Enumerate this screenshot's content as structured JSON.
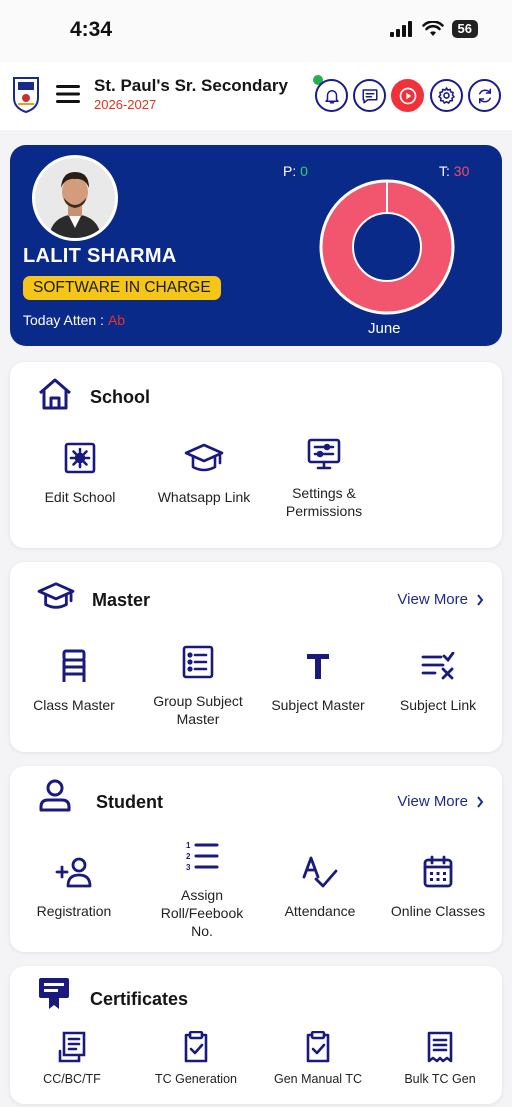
{
  "status_bar": {
    "time": "4:34",
    "battery": "56"
  },
  "header": {
    "school_name": "St. Paul's Sr. Secondary",
    "session": "2026-2027",
    "icons": [
      "bell-icon",
      "chat-icon",
      "play-icon",
      "gear-icon",
      "refresh-icon"
    ]
  },
  "profile": {
    "name": "LALIT SHARMA",
    "role": "SOFTWARE IN CHARGE",
    "attendance_label": "Today Atten :",
    "attendance_value": "Ab",
    "p_label": "P:",
    "p_value": "0",
    "t_label": "T:",
    "t_value": "30",
    "month": "June",
    "colors": {
      "card": "#0a2a8a",
      "donut": "#f2566f",
      "present": "#2bd36b",
      "total": "#f24b6a"
    }
  },
  "school_section": {
    "title": "School",
    "items": [
      {
        "label": "Edit School",
        "icon": "settings-box-icon"
      },
      {
        "label": "Whatsapp Link",
        "icon": "graduation-cap-icon"
      },
      {
        "label": "Settings & Permissions",
        "icon": "monitor-sliders-icon"
      }
    ]
  },
  "master_section": {
    "title": "Master",
    "view_more": "View More",
    "items": [
      {
        "label": "Class Master",
        "icon": "chair-icon"
      },
      {
        "label": "Group Subject Master",
        "icon": "list-box-icon"
      },
      {
        "label": "Subject Master",
        "icon": "text-t-icon"
      },
      {
        "label": "Subject Link",
        "icon": "list-check-icon"
      }
    ]
  },
  "student_section": {
    "title": "Student",
    "view_more": "View More",
    "items": [
      {
        "label": "Registration",
        "icon": "add-user-icon"
      },
      {
        "label": "Assign Roll/Feebook No.",
        "icon": "numbered-list-icon"
      },
      {
        "label": "Attendance",
        "icon": "spellcheck-icon"
      },
      {
        "label": "Online Classes",
        "icon": "calendar-icon"
      }
    ]
  },
  "certificates_section": {
    "title": "Certificates",
    "items": [
      {
        "label": "CC/BC/TF",
        "icon": "certificate-icon"
      },
      {
        "label": "TC Generation",
        "icon": "clipboard-check-icon"
      },
      {
        "label": "Gen Manual TC",
        "icon": "clipboard-check-icon"
      },
      {
        "label": "Bulk TC Gen",
        "icon": "document-lines-icon"
      }
    ]
  }
}
